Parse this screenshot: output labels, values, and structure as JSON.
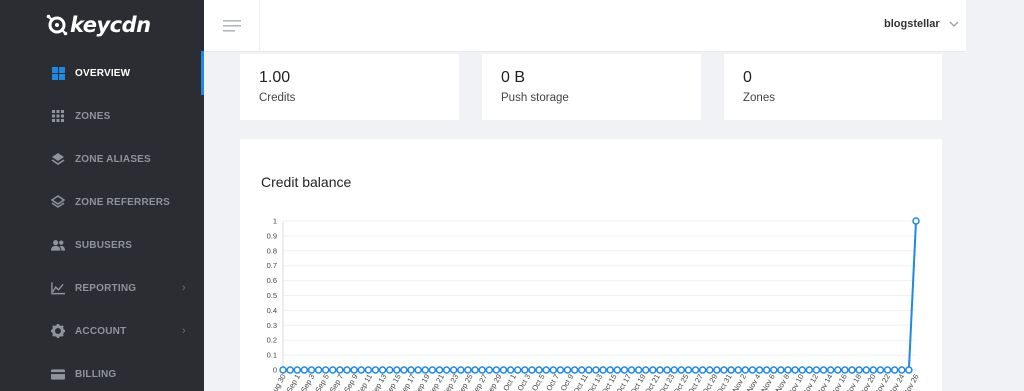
{
  "brand": {
    "name": "keycdn"
  },
  "sidebar": {
    "items": [
      {
        "label": "OVERVIEW",
        "icon": "grid-4-icon",
        "active": true,
        "has_submenu": false
      },
      {
        "label": "ZONES",
        "icon": "grid-9-icon",
        "active": false,
        "has_submenu": false
      },
      {
        "label": "ZONE ALIASES",
        "icon": "layers-icon",
        "active": false,
        "has_submenu": false
      },
      {
        "label": "ZONE REFERRERS",
        "icon": "layers-outline-icon",
        "active": false,
        "has_submenu": false
      },
      {
        "label": "SUBUSERS",
        "icon": "users-icon",
        "active": false,
        "has_submenu": false
      },
      {
        "label": "REPORTING",
        "icon": "chart-line-icon",
        "active": false,
        "has_submenu": true
      },
      {
        "label": "ACCOUNT",
        "icon": "gear-icon",
        "active": false,
        "has_submenu": true
      },
      {
        "label": "BILLING",
        "icon": "credit-card-icon",
        "active": false,
        "has_submenu": false
      }
    ],
    "chevron": "›"
  },
  "topbar": {
    "username": "blogstellar"
  },
  "stats": [
    {
      "value": "1.00",
      "label": "Credits"
    },
    {
      "value": "0 B",
      "label": "Push storage"
    },
    {
      "value": "0",
      "label": "Zones"
    }
  ],
  "colors": {
    "accent": "#1e88e5",
    "sidebar_bg": "#2b2d32",
    "page_bg": "#f0f2f5"
  },
  "chart_data": {
    "type": "line",
    "title": "Credit balance",
    "xlabel": "",
    "ylabel": "",
    "ylim": [
      0,
      1
    ],
    "y_ticks": [
      "0",
      "0.1",
      "0.2",
      "0.3",
      "0.4",
      "0.5",
      "0.6",
      "0.7",
      "0.8",
      "0.9",
      "1"
    ],
    "x_tick_labels": [
      "Aug 30",
      "Sep 1",
      "Sep 3",
      "Sep 5",
      "Sep 7",
      "Sep 9",
      "Sep 11",
      "Sep 13",
      "Sep 15",
      "Sep 17",
      "Sep 19",
      "Sep 21",
      "Sep 23",
      "Sep 25",
      "Sep 27",
      "Sep 29",
      "Oct 1",
      "Oct 3",
      "Oct 5",
      "Oct 7",
      "Oct 9",
      "Oct 11",
      "Oct 13",
      "Oct 15",
      "Oct 17",
      "Oct 19",
      "Oct 21",
      "Oct 23",
      "Oct 25",
      "Oct 27",
      "Oct 29",
      "Oct 31",
      "Nov 2",
      "Nov 4",
      "Nov 6",
      "Nov 8",
      "Nov 10",
      "Nov 12",
      "Nov 14",
      "Nov 16",
      "Nov 18",
      "Nov 20",
      "Nov 22",
      "Nov 24",
      "Nov 26"
    ],
    "series": [
      {
        "values": [
          0,
          0,
          0,
          0,
          0,
          0,
          0,
          0,
          0,
          0,
          0,
          0,
          0,
          0,
          0,
          0,
          0,
          0,
          0,
          0,
          0,
          0,
          0,
          0,
          0,
          0,
          0,
          0,
          0,
          0,
          0,
          0,
          0,
          0,
          0,
          0,
          0,
          0,
          0,
          0,
          0,
          0,
          0,
          0,
          0,
          0,
          0,
          0,
          0,
          0,
          0,
          0,
          0,
          0,
          0,
          0,
          0,
          0,
          0,
          0,
          0,
          0,
          0,
          0,
          0,
          0,
          0,
          0,
          0,
          0,
          0,
          0,
          0,
          0,
          0,
          0,
          0,
          0,
          0,
          0,
          0,
          0,
          0,
          0,
          0,
          0,
          0,
          0,
          0,
          1
        ]
      }
    ],
    "grid": true,
    "line_color": "#1e88e5"
  }
}
